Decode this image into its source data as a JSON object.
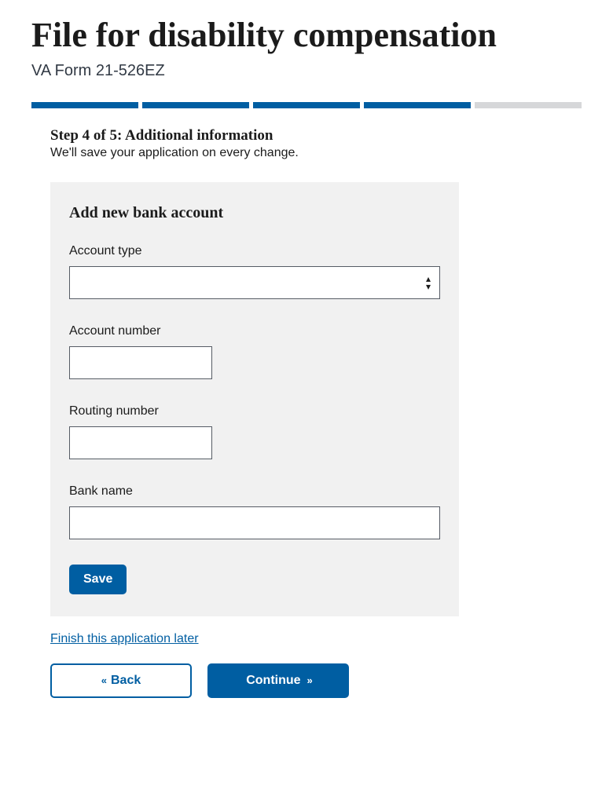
{
  "header": {
    "title": "File for disability compensation",
    "form_number": "VA Form 21-526EZ"
  },
  "progress": {
    "total": 5,
    "current": 4
  },
  "step": {
    "title": "Step 4 of 5: Additional information",
    "help": "We'll save your application on every change."
  },
  "card": {
    "title": "Add new bank account",
    "fields": {
      "account_type": {
        "label": "Account type",
        "value": ""
      },
      "account_number": {
        "label": "Account number",
        "value": ""
      },
      "routing_number": {
        "label": "Routing number",
        "value": ""
      },
      "bank_name": {
        "label": "Bank name",
        "value": ""
      }
    },
    "save_label": "Save"
  },
  "finish_later_label": "Finish this application later",
  "nav": {
    "back_label": "Back",
    "continue_label": "Continue"
  }
}
